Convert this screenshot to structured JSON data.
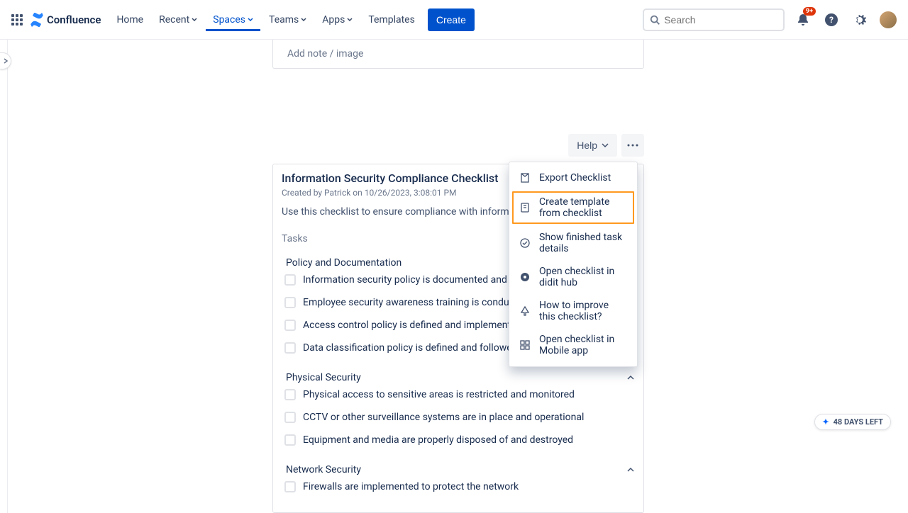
{
  "topbar": {
    "product": "Confluence",
    "nav": {
      "home": "Home",
      "recent": "Recent",
      "spaces": "Spaces",
      "teams": "Teams",
      "apps": "Apps",
      "templates": "Templates"
    },
    "create": "Create",
    "search_placeholder": "Search",
    "notif_badge": "9+"
  },
  "note_block": {
    "placeholder": "Add note / image"
  },
  "toolbar": {
    "help": "Help"
  },
  "checklist": {
    "title": "Information Security Compliance Checklist",
    "meta": "Created by Patrick on 10/26/2023, 3:08:01 PM",
    "description": "Use this checklist to ensure compliance with information security stand",
    "tasks_label": "Tasks",
    "sections": [
      {
        "title": "Policy and Documentation",
        "collapsible": false,
        "tasks": [
          "Information security policy is documented and up to date",
          "Employee security awareness training is conducted regularly",
          "Access control policy is defined and implemented",
          "Data classification policy is defined and followed"
        ]
      },
      {
        "title": "Physical Security",
        "collapsible": true,
        "tasks": [
          "Physical access to sensitive areas is restricted and monitored",
          "CCTV or other surveillance systems are in place and operational",
          "Equipment and media are properly disposed of and destroyed"
        ]
      },
      {
        "title": "Network Security",
        "collapsible": true,
        "tasks": [
          "Firewalls are implemented to protect the network"
        ]
      }
    ]
  },
  "dropdown": {
    "items": [
      "Export Checklist",
      "Create template from checklist",
      "Show finished task details",
      "Open checklist in didit hub",
      "How to improve this checklist?",
      "Open checklist in Mobile app"
    ],
    "highlighted_index": 1
  },
  "days_left": "48 DAYS LEFT"
}
